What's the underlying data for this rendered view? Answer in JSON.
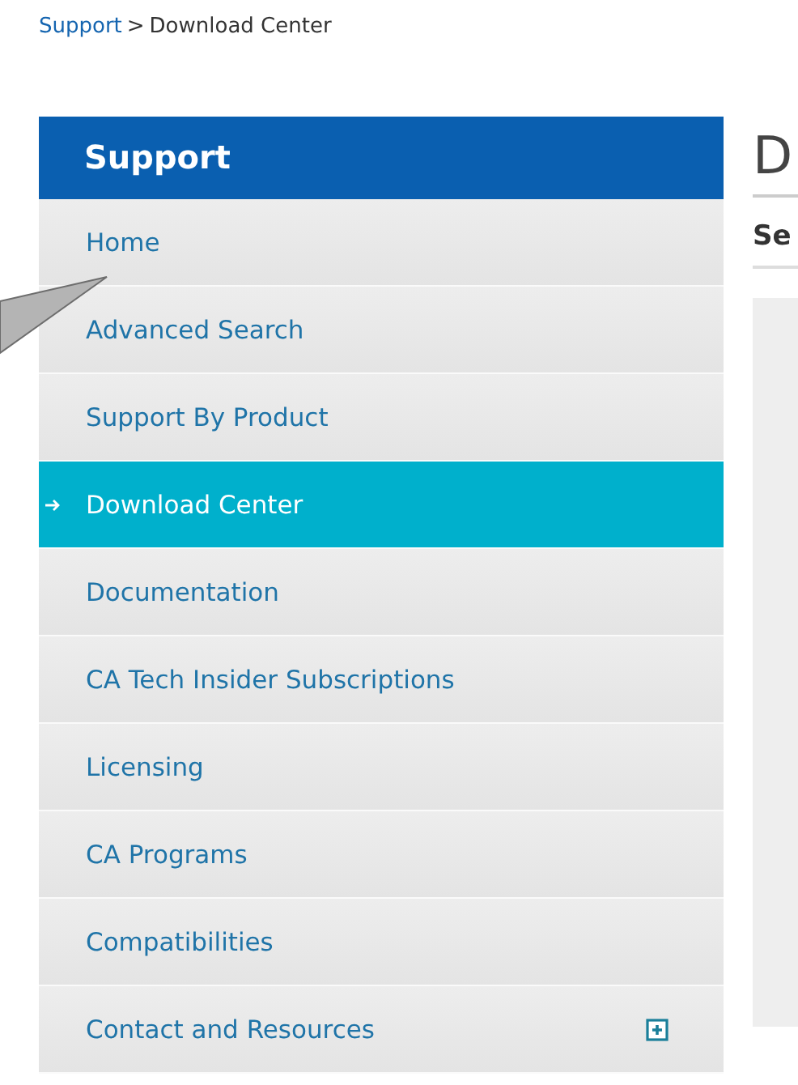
{
  "breadcrumb": {
    "items": [
      {
        "label": "Support",
        "kind": "link"
      },
      {
        "label": "Download Center",
        "kind": "current"
      }
    ],
    "separator": ">"
  },
  "sidebar": {
    "title": "Support",
    "items": [
      {
        "label": "Home",
        "selected": false,
        "expandable": false
      },
      {
        "label": "Advanced Search",
        "selected": false,
        "expandable": false
      },
      {
        "label": "Support By Product",
        "selected": false,
        "expandable": false
      },
      {
        "label": "Download Center",
        "selected": true,
        "expandable": false
      },
      {
        "label": "Documentation",
        "selected": false,
        "expandable": false
      },
      {
        "label": "CA Tech Insider Subscriptions",
        "selected": false,
        "expandable": false
      },
      {
        "label": "Licensing",
        "selected": false,
        "expandable": false
      },
      {
        "label": "CA Programs",
        "selected": false,
        "expandable": false
      },
      {
        "label": "Compatibilities",
        "selected": false,
        "expandable": false
      },
      {
        "label": "Contact and Resources",
        "selected": false,
        "expandable": true
      }
    ]
  },
  "main": {
    "heading": "D",
    "subheading": "Se"
  }
}
